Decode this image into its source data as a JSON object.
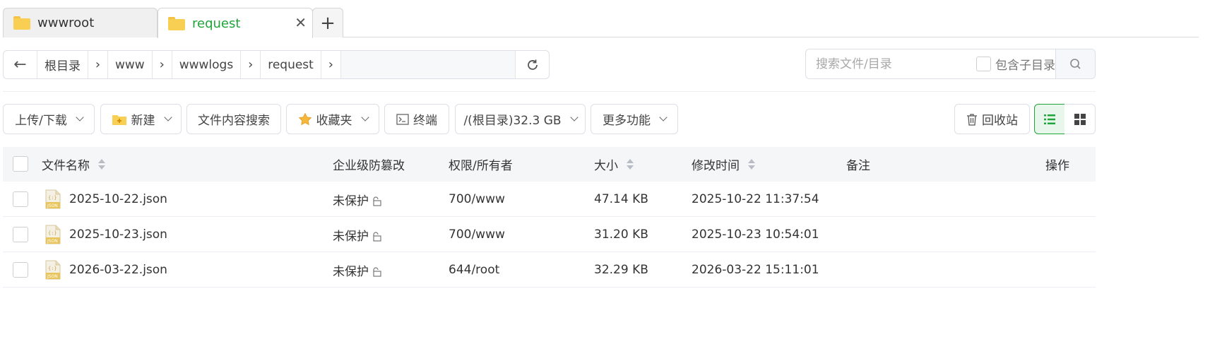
{
  "tabs": [
    {
      "label": "wwwroot",
      "active": false
    },
    {
      "label": "request",
      "active": true
    }
  ],
  "tab_close_glyph": "✕",
  "tab_add_glyph": "+",
  "breadcrumb": {
    "back_glyph": "←",
    "items": [
      "根目录",
      "www",
      "wwwlogs",
      "request"
    ],
    "separator": "›"
  },
  "search": {
    "placeholder": "搜索文件/目录",
    "value": "",
    "include_subdir_label": "包含子目录"
  },
  "toolbar": {
    "upload_download": "上传/下载",
    "new": "新建",
    "content_search": "文件内容搜索",
    "favorites": "收藏夹",
    "terminal": "终端",
    "disk": "/(根目录)32.3 GB",
    "more": "更多功能",
    "recycle_bin": "回收站"
  },
  "table": {
    "headers": {
      "name": "文件名称",
      "protect": "企业级防篡改",
      "perm": "权限/所有者",
      "size": "大小",
      "mtime": "修改时间",
      "note": "备注",
      "ops": "操作"
    },
    "rows": [
      {
        "name": "2025-10-22.json",
        "protect": "未保护",
        "perm": "700/www",
        "size": "47.14 KB",
        "mtime": "2025-10-22 11:37:54",
        "note": ""
      },
      {
        "name": "2025-10-23.json",
        "protect": "未保护",
        "perm": "700/www",
        "size": "31.20 KB",
        "mtime": "2025-10-23 10:54:01",
        "note": ""
      },
      {
        "name": "2026-03-22.json",
        "protect": "未保护",
        "perm": "644/root",
        "size": "32.29 KB",
        "mtime": "2026-03-22 15:11:01",
        "note": ""
      }
    ]
  },
  "icons": {
    "folder": "folder-icon",
    "refresh": "refresh-icon",
    "search": "search-icon",
    "star": "star-icon",
    "terminal": "terminal-icon",
    "trash": "trash-icon",
    "list_view": "list-view-icon",
    "grid_view": "grid-view-icon",
    "json_file": "json-file-icon",
    "lock": "unlock-icon"
  },
  "colors": {
    "accent": "#20a53a",
    "folder": "#f8cf52",
    "header_bg": "#f5f6f8"
  }
}
